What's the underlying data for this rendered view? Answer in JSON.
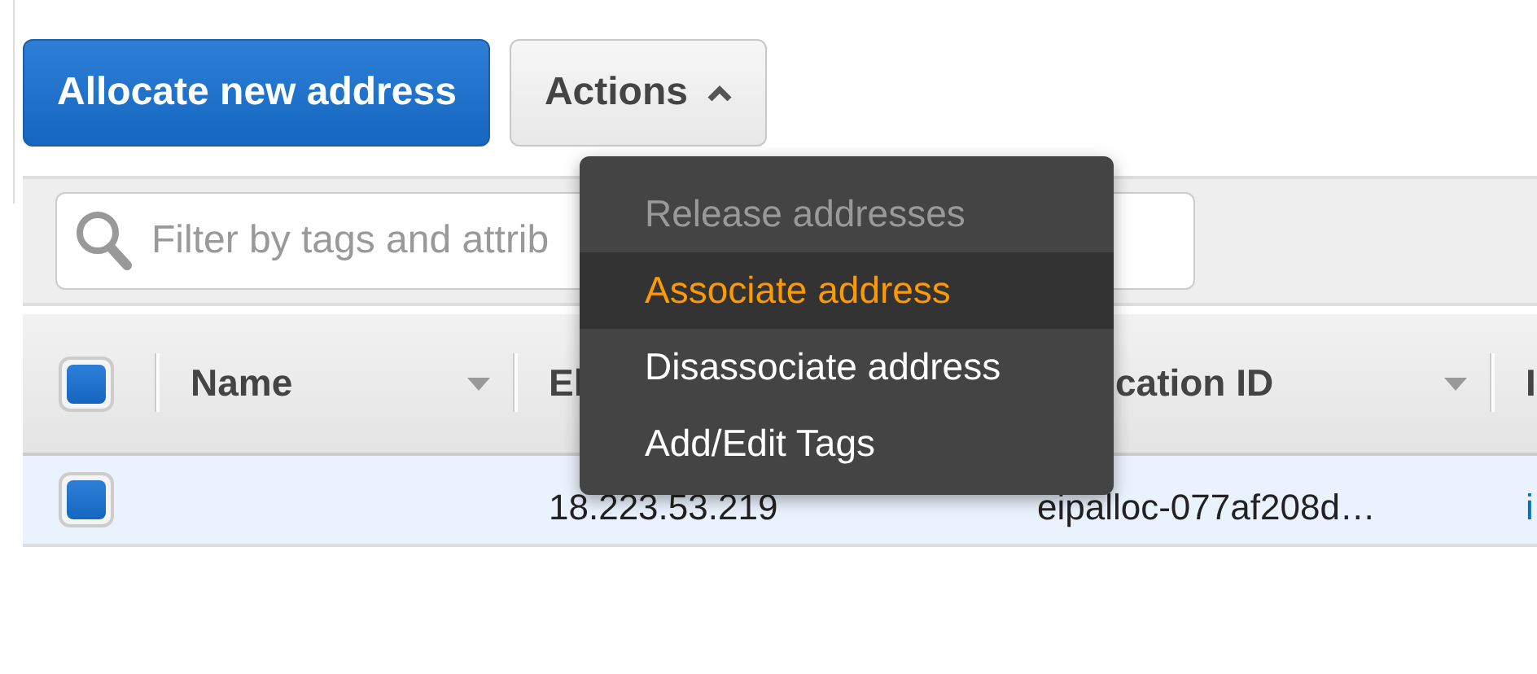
{
  "toolbar": {
    "buttons": [
      {
        "label": "Allocate new address",
        "kind": "primary"
      },
      {
        "label": "Actions",
        "kind": "dropdown",
        "expanded": true
      }
    ]
  },
  "actions_menu": {
    "items": [
      {
        "label": "Release addresses",
        "disabled": true,
        "selected": false
      },
      {
        "label": "Associate address",
        "disabled": false,
        "selected": true
      },
      {
        "label": "Disassociate address",
        "disabled": false,
        "selected": false
      },
      {
        "label": "Add/Edit Tags",
        "disabled": false,
        "selected": false
      }
    ]
  },
  "filter": {
    "placeholder": "Filter by tags and attrib"
  },
  "table": {
    "select_all_checked": true,
    "columns": [
      {
        "label": "Name",
        "sort_caret": true
      },
      {
        "label": "El",
        "sort_caret": false
      },
      {
        "label": "cation ID",
        "sort_caret": true
      },
      {
        "label": "I",
        "sort_caret": false
      }
    ],
    "rows": [
      {
        "checked": true,
        "selected": true,
        "column_2": "18.223.53.219",
        "column_3": "eipalloc-077af208d…",
        "column_4": "i"
      }
    ]
  }
}
